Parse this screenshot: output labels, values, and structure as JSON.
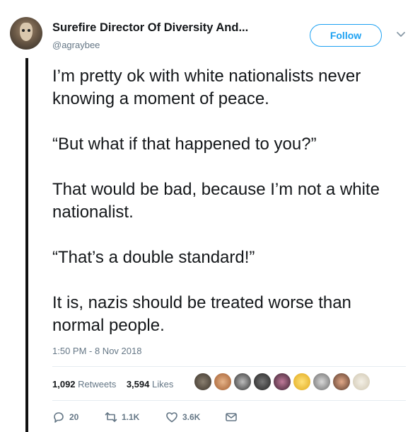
{
  "user": {
    "display_name": "Surefire Director Of Diversity And...",
    "handle": "@agraybee"
  },
  "follow_label": "Follow",
  "tweet_paragraphs": [
    "I’m pretty ok with white nationalists never knowing a moment of peace.",
    "“But what if that happened to you?”",
    "That would be bad, because I’m not a white nationalist.",
    "“That’s a double standard!”",
    "It is, nazis should be treated worse than normal people."
  ],
  "timestamp": "1:50 PM - 8 Nov 2018",
  "stats": {
    "retweets_count": "1,092",
    "retweets_label": "Retweets",
    "likes_count": "3,594",
    "likes_label": "Likes"
  },
  "actions": {
    "replies": "20",
    "retweets": "1.1K",
    "likes": "3.6K"
  },
  "colors": {
    "accent": "#1da1f2",
    "text": "#14171a",
    "muted": "#657786"
  }
}
